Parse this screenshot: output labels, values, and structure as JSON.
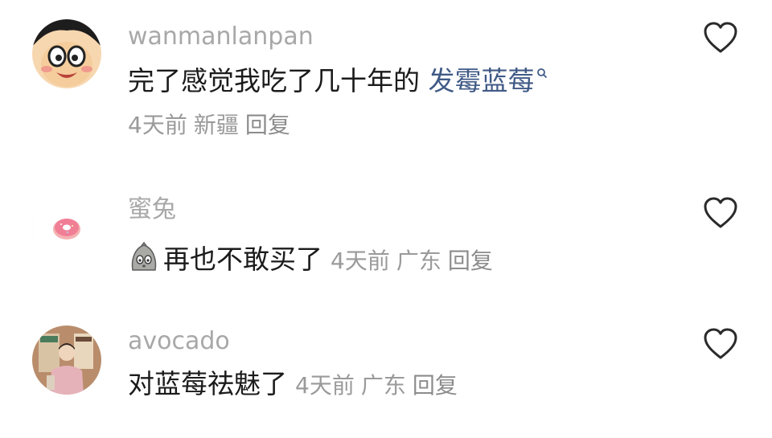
{
  "comments": [
    {
      "username": "wanmanlanpan",
      "text": "完了感觉我吃了几十年的 ",
      "link_text": "发霉蓝莓",
      "time": "4天前",
      "location": "新疆",
      "reply_label": "回复",
      "avatar_icon": "cartoon-face-avatar-icon",
      "like_icon": "heart-outline-icon"
    },
    {
      "username": "蜜兔",
      "text": "再也不敢买了",
      "time": "4天前",
      "location": "广东",
      "reply_label": "回复",
      "avatar_icon": "donut-avatar-icon",
      "emoji_icon": "scared-face-emoji-icon",
      "like_icon": "heart-outline-icon"
    },
    {
      "username": "avocado",
      "text": "对蓝莓祛魅了",
      "time": "4天前",
      "location": "广东",
      "reply_label": "回复",
      "avatar_icon": "photo-avatar-icon",
      "like_icon": "heart-outline-icon"
    }
  ],
  "colors": {
    "username": "#a8a8a8",
    "text": "#1b1b1b",
    "meta": "#9a9a9a",
    "link": "#405a86",
    "heart": "#2a2a2a"
  }
}
